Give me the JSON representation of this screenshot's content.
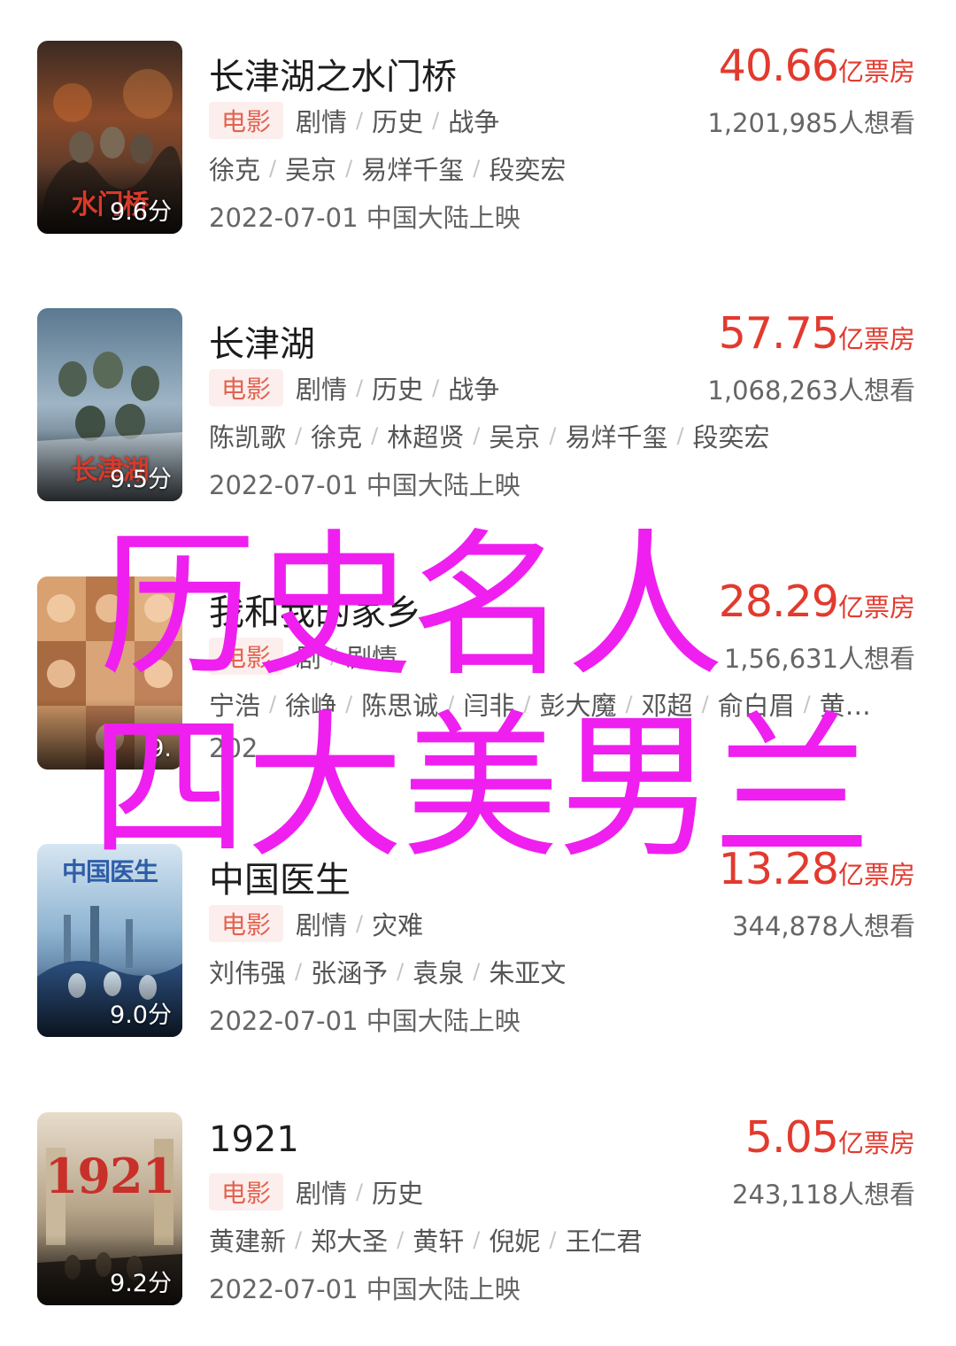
{
  "overlay": {
    "line1": "历史名人",
    "line2": "四大美男兰",
    "color": "#ef1ff0"
  },
  "colors": {
    "accent": "#e23a2e",
    "badge_bg": "#fdeeee",
    "badge_text": "#e1644f"
  },
  "movies": [
    {
      "poster_text": "水门桥",
      "score": "9.6分",
      "title": "长津湖之水门桥",
      "type": "电影",
      "genres": [
        "剧情",
        "历史",
        "战争"
      ],
      "cast": [
        "徐克",
        "吴京",
        "易烊千玺",
        "段奕宏"
      ],
      "release": "2022-07-01 中国大陆上映",
      "box_value": "40.66",
      "box_unit": "亿票房",
      "want": "1,201,985人想看"
    },
    {
      "poster_text": "长津湖",
      "score": "9.5分",
      "title": "长津湖",
      "type": "电影",
      "genres": [
        "剧情",
        "历史",
        "战争"
      ],
      "cast": [
        "陈凯歌",
        "徐克",
        "林超贤",
        "吴京",
        "易烊千玺",
        "段奕宏"
      ],
      "release": "2022-07-01 中国大陆上映",
      "box_value": "57.75",
      "box_unit": "亿票房",
      "want": "1,068,263人想看"
    },
    {
      "poster_text": "",
      "score": "9.",
      "title": "我和我的家乡",
      "type": "电影",
      "genres": [
        "剧",
        "剧情"
      ],
      "cast": [
        "宁浩",
        "徐峥",
        "陈思诚",
        "闫非",
        "彭大魔",
        "邓超",
        "俞白眉",
        "黄…"
      ],
      "release": "202",
      "box_value": "28.29",
      "box_unit": "亿票房",
      "want": "1,56,631人想看"
    },
    {
      "poster_text": "中国医生",
      "score": "9.0分",
      "title": "中国医生",
      "type": "电影",
      "genres": [
        "剧情",
        "灾难"
      ],
      "cast": [
        "刘伟强",
        "张涵予",
        "袁泉",
        "朱亚文"
      ],
      "release": "2022-07-01 中国大陆上映",
      "box_value": "13.28",
      "box_unit": "亿票房",
      "want": "344,878人想看"
    },
    {
      "poster_text": "1921",
      "score": "9.2分",
      "title": "1921",
      "type": "电影",
      "genres": [
        "剧情",
        "历史"
      ],
      "cast": [
        "黄建新",
        "郑大圣",
        "黄轩",
        "倪妮",
        "王仁君"
      ],
      "release": "2022-07-01 中国大陆上映",
      "box_value": "5.05",
      "box_unit": "亿票房",
      "want": "243,118人想看"
    }
  ]
}
